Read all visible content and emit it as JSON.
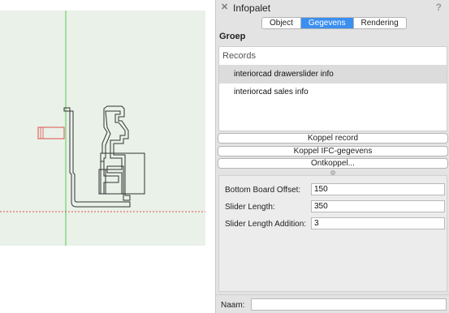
{
  "palette": {
    "title": "Infopalet",
    "help_symbol": "?",
    "close_symbol": "✕",
    "tabs": [
      {
        "label": "Object",
        "active": false
      },
      {
        "label": "Gegevens",
        "active": true
      },
      {
        "label": "Rendering",
        "active": false
      }
    ],
    "group_label": "Groep",
    "records": {
      "header": "Records",
      "items": [
        {
          "label": "interiorcad drawerslider info",
          "selected": true
        },
        {
          "label": "interiorcad sales info",
          "selected": false
        }
      ]
    },
    "buttons": {
      "attach_record": "Koppel record",
      "attach_ifc": "Koppel IFC-gegevens",
      "detach": "Ontkoppel..."
    },
    "fields": [
      {
        "label": "Bottom Board Offset:",
        "value": "150"
      },
      {
        "label": "Slider Length:",
        "value": "350"
      },
      {
        "label": "Slider Length Addition:",
        "value": "3"
      }
    ],
    "name_label": "Naam:",
    "name_value": ""
  },
  "colors": {
    "canvas_background": "#e9f1e8",
    "guide_line": "#55cc55",
    "dashed_line": "#e05050",
    "accent_tab": "#3b8ff0"
  }
}
